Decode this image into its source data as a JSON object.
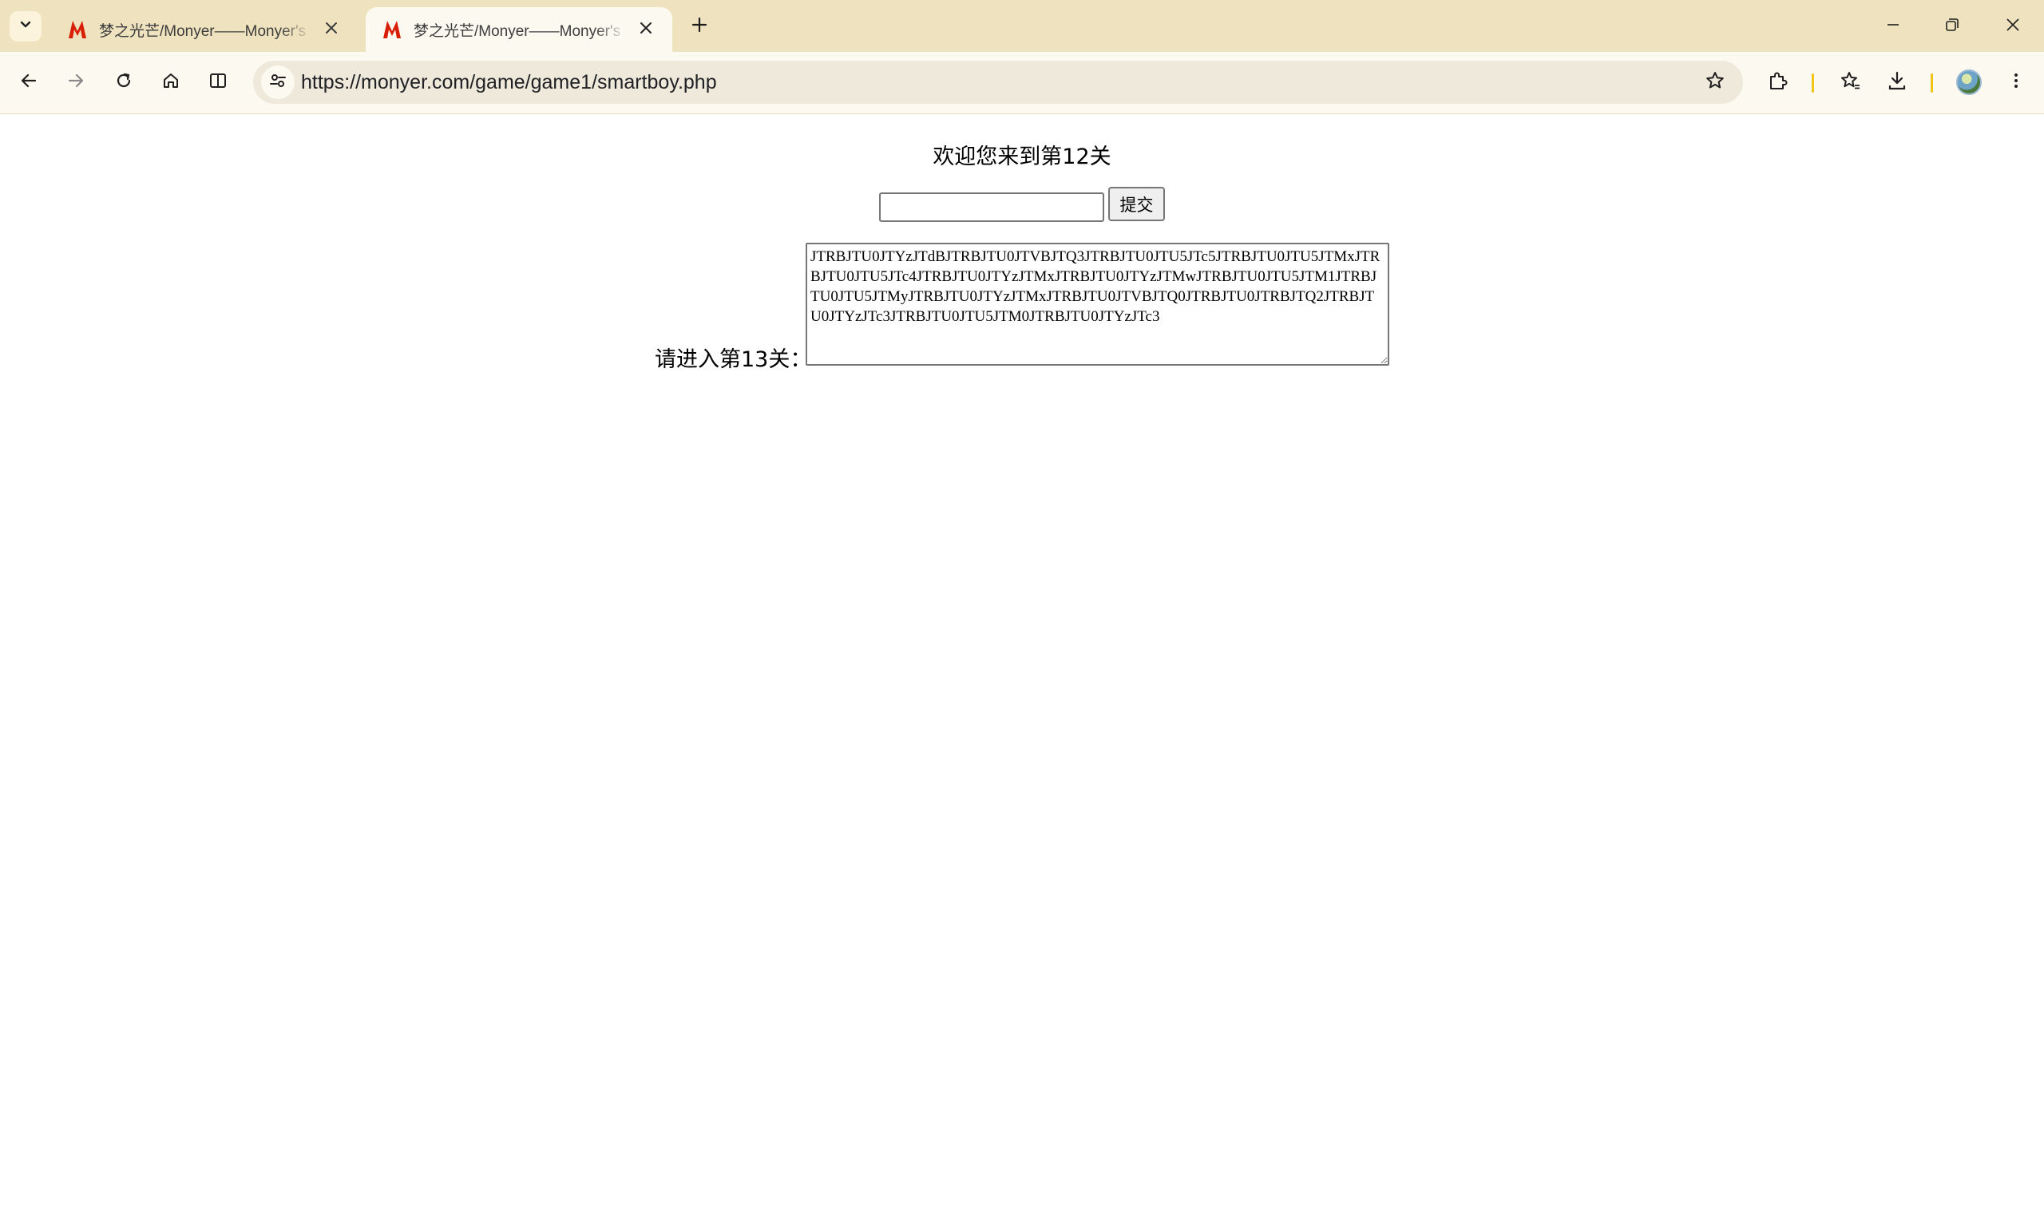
{
  "browser": {
    "tabs": [
      {
        "title": "梦之光芒/Monyer——Monyer's Game",
        "active": false
      },
      {
        "title": "梦之光芒/Monyer——Monyer's Game",
        "active": true
      }
    ],
    "address_bar": {
      "url": "https://monyer.com/game/game1/smartboy.php"
    },
    "accent_colors": {
      "tabstrip": "#efe3bf",
      "toolbar": "#fcf9f1",
      "favicon": "#d81e06",
      "separator": "#f3c418"
    }
  },
  "page": {
    "welcome_text": "欢迎您来到第12关",
    "answer_input": {
      "value": "",
      "placeholder": ""
    },
    "submit_label": "提交",
    "next_level_label": "请进入第13关：",
    "cipher_text": "JTRBJTU0JTYzJTdBJTRBJTU0JTVBJTQ3JTRBJTU0JTU5JTc5JTRBJTU0JTU5JTMxJTRBJTU0JTU5JTc4JTRBJTU0JTYzJTMxJTRBJTU0JTYzJTMwJTRBJTU0JTU5JTM1JTRBJTU0JTU5JTMyJTRBJTU0JTYzJTMxJTRBJTU0JTVBJTQ0JTRBJTU0JTRBJTQ2JTRBJTU0JTYzJTc3JTRBJTU0JTU5JTM0JTRBJTU0JTYzJTc3"
  }
}
